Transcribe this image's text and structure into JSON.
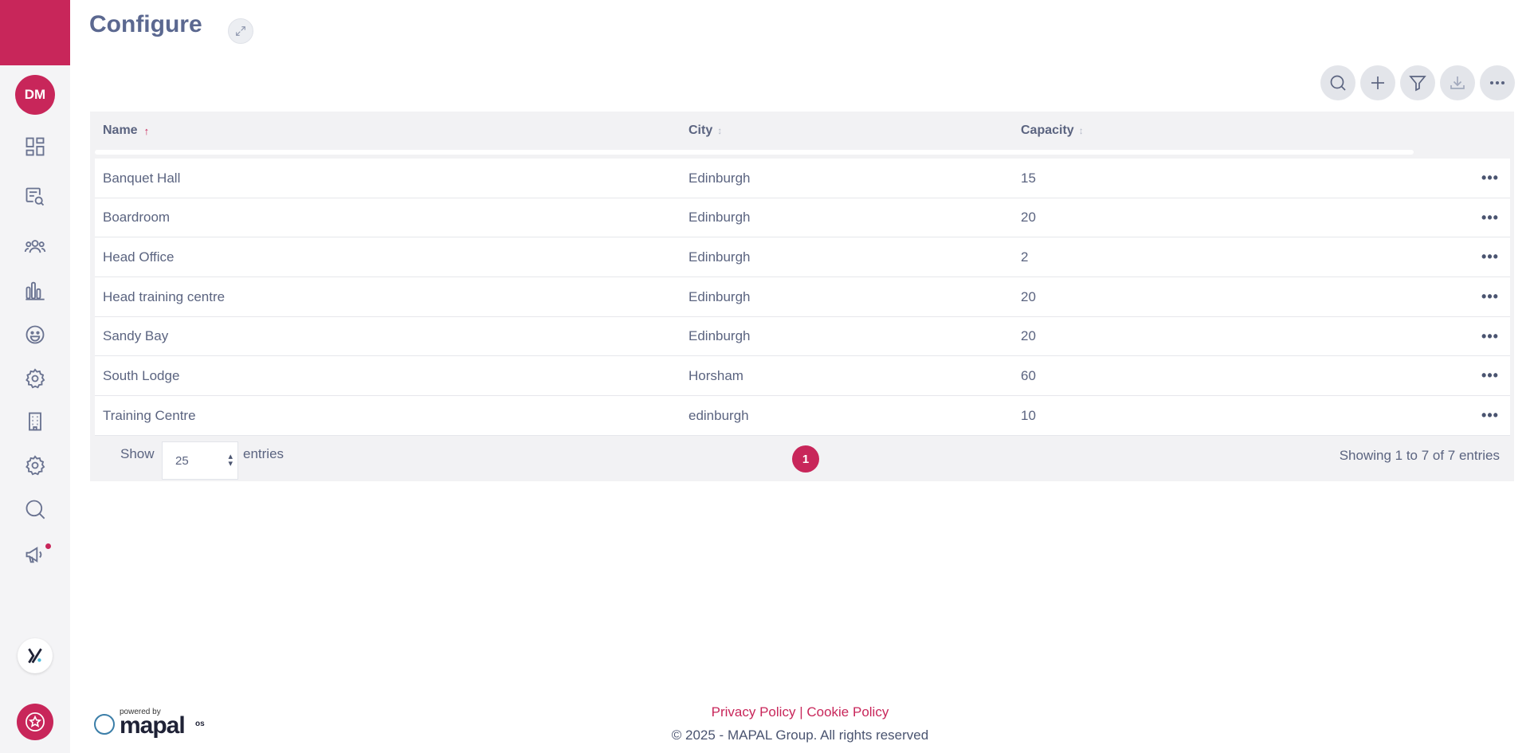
{
  "app": {
    "accent_color": "#c8265a"
  },
  "sidebar": {
    "avatar_initials": "DM",
    "items": [
      {
        "icon": "dashboard-icon"
      },
      {
        "icon": "document-search-icon"
      },
      {
        "icon": "people-icon"
      },
      {
        "icon": "bar-chart-icon"
      },
      {
        "icon": "smiley-icon"
      },
      {
        "icon": "gear-icon"
      },
      {
        "icon": "building-icon"
      },
      {
        "icon": "gear-icon"
      },
      {
        "icon": "search-icon"
      },
      {
        "icon": "megaphone-icon"
      }
    ]
  },
  "header": {
    "title": "Configure"
  },
  "toolbar": {
    "buttons": [
      "search-icon",
      "plus-icon",
      "filter-icon",
      "download-icon",
      "more-icon"
    ]
  },
  "table": {
    "columns": [
      {
        "label": "Name",
        "sort": "asc"
      },
      {
        "label": "City",
        "sort": "none"
      },
      {
        "label": "Capacity",
        "sort": "none"
      }
    ],
    "rows": [
      {
        "name": "Banquet Hall",
        "city": "Edinburgh",
        "capacity": "15"
      },
      {
        "name": "Boardroom",
        "city": "Edinburgh",
        "capacity": "20"
      },
      {
        "name": "Head Office",
        "city": "Edinburgh",
        "capacity": "2"
      },
      {
        "name": "Head training centre",
        "city": "Edinburgh",
        "capacity": "20"
      },
      {
        "name": "Sandy Bay",
        "city": "Edinburgh",
        "capacity": "20"
      },
      {
        "name": "South Lodge",
        "city": "Horsham",
        "capacity": "60"
      },
      {
        "name": "Training Centre",
        "city": "edinburgh",
        "capacity": "10"
      }
    ],
    "row_menu_glyph": "•••",
    "footer": {
      "show_label": "Show",
      "page_size": "25",
      "entries_label": "entries",
      "current_page": "1",
      "showing_text": "Showing 1 to 7 of 7 entries"
    }
  },
  "footer": {
    "powered_by": "powered by",
    "brand": "mapal",
    "brand_suffix": "os",
    "privacy_link": "Privacy Policy",
    "separator": "|",
    "cookie_link": "Cookie Policy",
    "copyright": "© 2025 - MAPAL Group. All rights reserved"
  }
}
